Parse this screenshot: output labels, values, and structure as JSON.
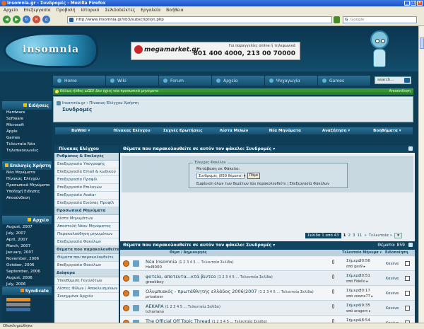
{
  "window": {
    "title": "Insomnia.gr - Συνδρομές - Mozilla Firefox"
  },
  "menubar": [
    "Αρχείο",
    "Επεξεργασία",
    "Προβολή",
    "Ιστορικό",
    "Σελιδοδείκτες",
    "Εργαλεία",
    "Βοήθεια"
  ],
  "nav": {
    "url": "http://www.insomnia.gr/vb3/subscription.php",
    "search_placeholder": "Google"
  },
  "site": {
    "logo": "insomnia",
    "ad": {
      "brand": "megamarket.gr",
      "tagline": "Για παραγγελίες online ή τηλεφωνικά",
      "phones": "801 400 4000, 213 00 70000"
    },
    "topnav": [
      "Home",
      "Wiki",
      "Forum",
      "Αρχεία",
      "Ψυχαγωγία",
      "Games"
    ],
    "search_placeholder": "search...",
    "warning": "Κάλως ήλθες ωΩΩ! Δεν έχεις νέα προσωπικά μηνύματα",
    "warning_right": "Αποσύνδεση"
  },
  "sidebar": {
    "news": {
      "title": "Ειδήσεις",
      "items": [
        "Hardware",
        "Software",
        "Microsoft",
        "Apple",
        "Games",
        "Τελευταία Νέα",
        "Τηλεπικοινωνίες"
      ]
    },
    "user": {
      "title": "Επιλογές Χρήστη",
      "items": [
        "Νέα Μηνύματα",
        "Πίνακας Ελέγχου",
        "Προσωπικά Μηνύματα",
        "Υποδοχή Ειδησης",
        "Αποσύνδεση"
      ]
    },
    "archive": {
      "title": "Αρχείο",
      "items": [
        "August, 2007",
        "July, 2007",
        "April, 2007",
        "March, 2007",
        "January, 2007",
        "November, 2006",
        "October, 2006",
        "September, 2006",
        "August, 2006",
        "July, 2006"
      ]
    },
    "syndicate": {
      "title": "Syndicate"
    }
  },
  "breadcrumb": {
    "path": "Insomnia.gr › Πίνακας Ελέγχου Χρήστη",
    "title": "Συνδρομές"
  },
  "subnav": [
    "BuWiki ▾",
    "Πίνακας Ελέγχου",
    "Συχνές Ερωτήσεις",
    "Λίστα Μελών",
    "Νέα Μηνύματα",
    "Αναζήτηση ▾",
    "Βοηθήματα ▾"
  ],
  "controlpanel": {
    "title": "Πίνακας Ελέγχου",
    "items": [
      {
        "label": "Ρυθμίσεις & Επιλογές",
        "type": "sec"
      },
      {
        "label": "Επεξεργασία Υπογραφής",
        "type": "it"
      },
      {
        "label": "Επεξεργασία Email & κωδικού",
        "type": "it"
      },
      {
        "label": "Επεξεργασία Προφίλ",
        "type": "it"
      },
      {
        "label": "Επεξεργασία Επιλογών",
        "type": "it"
      },
      {
        "label": "Επεξεργασία Avatar",
        "type": "it"
      },
      {
        "label": "Επεξεργασία Εικόνας Προφίλ",
        "type": "it"
      },
      {
        "label": "Προσωπικά Μηνύματα",
        "type": "sec"
      },
      {
        "label": "Λίστα Μηνυμάτων",
        "type": "it"
      },
      {
        "label": "Αποστολή Νέου Μηνύματος",
        "type": "it"
      },
      {
        "label": "Παρακολούθηση μηνυμάτων",
        "type": "it"
      },
      {
        "label": "Επεξεργασία Φακέλων",
        "type": "it"
      },
      {
        "label": "Θέματα που παρακολουθείτε",
        "type": "sec"
      },
      {
        "label": "Θέματα που παρακολουθείτε",
        "type": "active"
      },
      {
        "label": "Επεξεργασία Φακέλων",
        "type": "it"
      },
      {
        "label": "Διάφορα",
        "type": "sec"
      },
      {
        "label": "Υπενθύμιση Γεγονότων",
        "type": "it"
      },
      {
        "label": "Λίστες Φίλων / Αποκλεισμένων",
        "type": "it"
      },
      {
        "label": "Συνημμένα Αρχεία",
        "type": "it"
      }
    ]
  },
  "main": {
    "header": "Θέματα που παρακολουθείτε σε αυτόν τον φάκελο: Συνδρομές ▾",
    "folder": {
      "legend": "Έλεγχος Φακέλου",
      "label": "Μετάβαση σε Φάκελο:",
      "selected": "Συνδρομές (859 θέματα)",
      "go": "Πάμε",
      "description": "Εμφάνιση όλων των θεμάτων που παρακολουθείτε | Επεξεργασία Φακέλων"
    },
    "pager": {
      "label": "Σελίδα 1 από 43",
      "current": "1",
      "pages": [
        "2",
        "3",
        "11",
        "»",
        "Τελευταία »"
      ],
      "dropdown": "▾"
    },
    "threads_header": "Θέματα που παρακολουθείτε σε αυτόν τον φάκελο: Συνδρομές ▾",
    "threads_count": "Θέματα: 859",
    "columns": [
      "Θέμα / Δημιουργός",
      "Τελευταίο Μήνυμα ▾",
      "Ειδοποίηση"
    ],
    "threads": [
      {
        "title": "Νέα Insomnia",
        "pages": "(1 2 3 4 5 ... Τελευταία Σελίδα)",
        "author": "Hel9000",
        "date": "Σήμερα",
        "time": "20:56",
        "by": "από gas9 ▸",
        "notif": "Κανένα"
      },
      {
        "title": "φοτεία, αποτευτα...κτά βιντεο",
        "pages": "(1 2 3 4 5 ... Τελευταία Σελίδα)",
        "author": "greekboy",
        "date": "Σήμερα",
        "time": "20:51",
        "by": "από Fidello ▸",
        "notif": "Κανένα"
      },
      {
        "title": "Ολυμπιακός - πρωτάθλητής ελλάδος 2006/2007",
        "pages": "(1 2 3 4 5 ... Τελευταία Σελίδα)",
        "author": "privateer",
        "date": "Σήμερα",
        "time": "20:17",
        "by": "από zoozra77 ▸",
        "notif": "Κανένα"
      },
      {
        "title": "ΑΕΚΑΡΑ",
        "pages": "(1 2 3 4 5 ... Τελευταία Σελίδα)",
        "author": "tchoriano",
        "date": "Σήμερα",
        "time": "19:35",
        "by": "από aragorn ▸",
        "notif": "Κανένα"
      },
      {
        "title": "The Official Off Topic Thread",
        "pages": "(1 2 3 4 5 ... Τελευταία Σελίδα)",
        "author": "Lucifer",
        "date": "Σήμερα",
        "time": "18:54",
        "by": "από Anemoi ▸",
        "notif": "Κανένα"
      },
      {
        "title": "ΠΑΝΑΘΗΝΑΙΚΟΣ - Triple Crown 2006 / 2007",
        "pages": "(1 2 3 4 5 ... Τελευταία Σελίδα)",
        "author": "BOUGAS",
        "date": "Σήμερα",
        "time": "18:49",
        "by": "από KWSN_Me ▸",
        "notif": "Κανένα"
      }
    ]
  },
  "status": "Ολοκληρώθηκε"
}
